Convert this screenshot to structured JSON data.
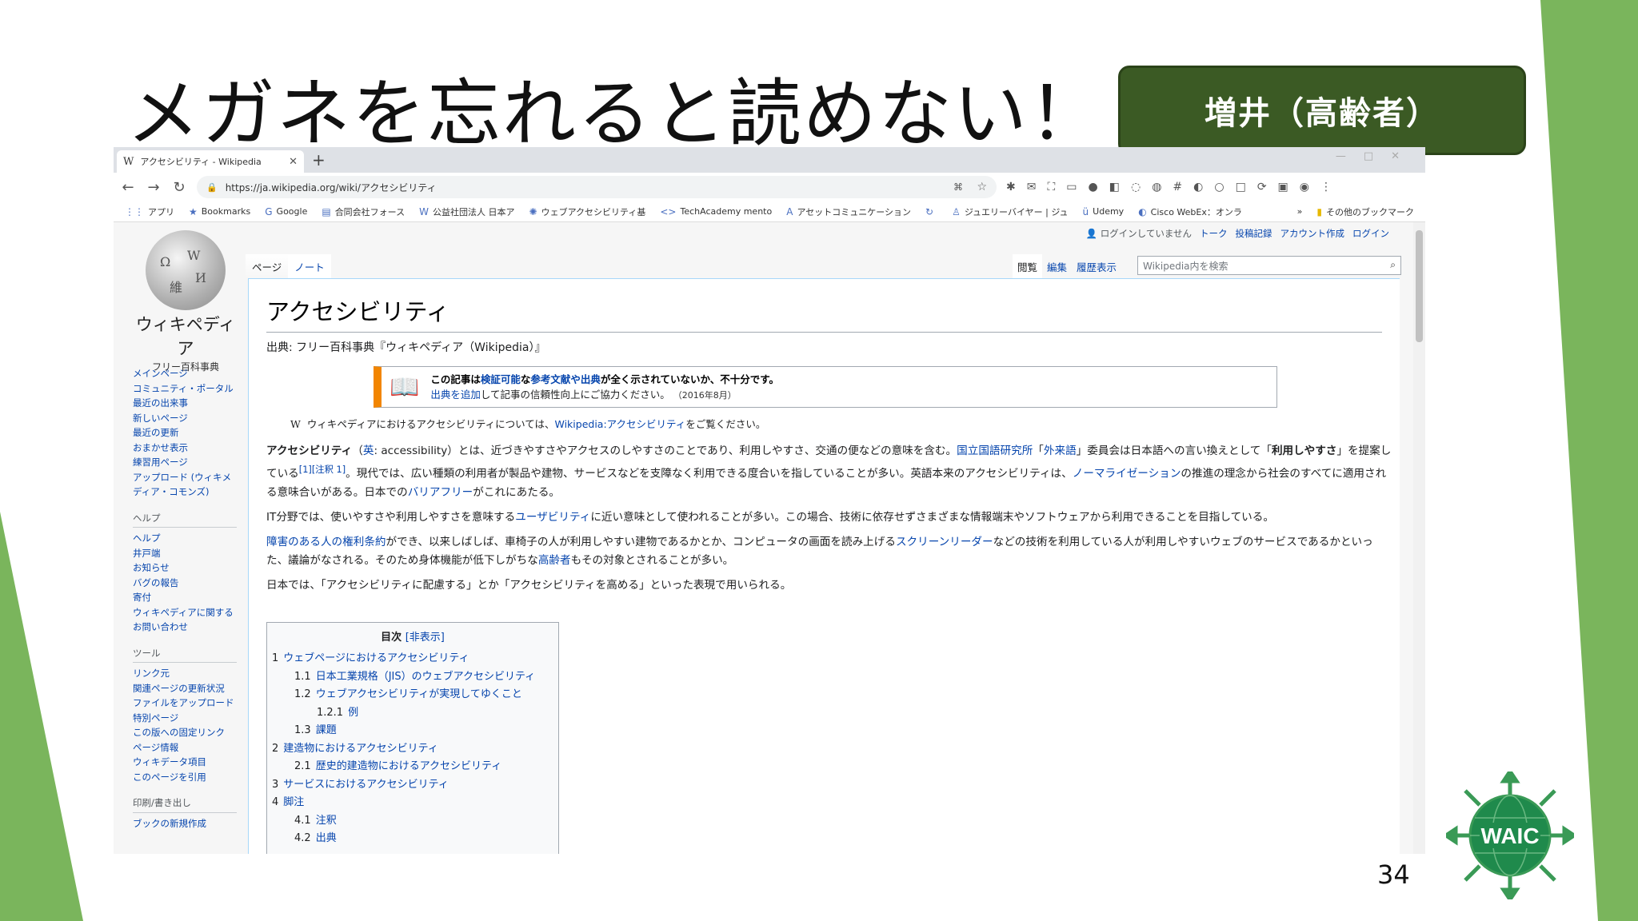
{
  "slide": {
    "title": "メガネを忘れると読めない！",
    "persona": "増井（高齢者）",
    "page_number": "34",
    "logo_text": "WAIC"
  },
  "colors": {
    "accent_green": "#7ab55c",
    "persona_bg": "#3b5a24",
    "link": "#0645ad",
    "ambox_border": "#f28500"
  },
  "browser": {
    "tab_title": "アクセシビリティ - Wikipedia",
    "url": "https://ja.wikipedia.org/wiki/アクセシビリティ",
    "bookmarks": [
      {
        "icon": "apps-icon",
        "label": "アプリ"
      },
      {
        "icon": "star-icon",
        "label": "Bookmarks"
      },
      {
        "icon": "google-icon",
        "label": "Google"
      },
      {
        "icon": "folder-icon",
        "label": "合同会社フォース"
      },
      {
        "icon": "w-icon",
        "label": "公益社団法人 日本ア"
      },
      {
        "icon": "gear-icon",
        "label": "ウェブアクセシビリティ基"
      },
      {
        "icon": "code-icon",
        "label": "TechAcademy mento"
      },
      {
        "icon": "a-icon",
        "label": "アセットコミュニケーション"
      },
      {
        "icon": "refresh-icon",
        "label": ""
      },
      {
        "icon": "person-icon",
        "label": "ジュエリーバイヤー | ジュ"
      },
      {
        "icon": "udemy-icon",
        "label": "Udemy"
      },
      {
        "icon": "webex-icon",
        "label": "Cisco WebEx：オンラ"
      }
    ],
    "more_bookmarks": "»",
    "other_bookmarks": "その他のブックマーク"
  },
  "wiki": {
    "site_name": "ウィキペディア",
    "site_sub": "フリー百科事典",
    "personal": {
      "not_logged": "ログインしていません",
      "talk": "トーク",
      "contribs": "投稿記録",
      "create": "アカウント作成",
      "login": "ログイン"
    },
    "ns_tabs": {
      "page": "ページ",
      "note": "ノート"
    },
    "view_tabs": {
      "read": "閲覧",
      "edit": "編集",
      "history": "履歴表示"
    },
    "search_placeholder": "Wikipedia内を検索",
    "nav": [
      "メインページ",
      "コミュニティ・ポータル",
      "最近の出来事",
      "新しいページ",
      "最近の更新",
      "おまかせ表示",
      "練習用ページ",
      "アップロード (ウィキメディア・コモンズ)"
    ],
    "help_heading": "ヘルプ",
    "help": [
      "ヘルプ",
      "井戸端",
      "お知らせ",
      "バグの報告",
      "寄付",
      "ウィキペディアに関するお問い合わせ"
    ],
    "tools_heading": "ツール",
    "tools": [
      "リンク元",
      "関連ページの更新状況",
      "ファイルをアップロード",
      "特別ページ",
      "この版への固定リンク",
      "ページ情報",
      "ウィキデータ項目",
      "このページを引用"
    ],
    "print_heading": "印刷/書き出し",
    "print": [
      "ブックの新規作成"
    ],
    "article": {
      "title": "アクセシビリティ",
      "source": "出典: フリー百科事典『ウィキペディア（Wikipedia）』",
      "ambox_p1": "この記事は",
      "ambox_l1": "検証可能",
      "ambox_p2": "な",
      "ambox_l2": "参考文献や出典",
      "ambox_p3": "が全く示されていないか、不十分です。",
      "ambox_l3": "出典を追加",
      "ambox_p4": "して記事の信頼性向上にご協力ください。",
      "ambox_date": "（2016年8月）",
      "hatnote_pre": "ウィキペディアにおけるアクセシビリティについては、",
      "hatnote_link": "Wikipedia:アクセシビリティ",
      "hatnote_post": "をご覧ください。",
      "p1_a": "アクセシビリティ",
      "p1_b": "（",
      "p1_c": "英",
      "p1_d": ": accessibility）とは、近づきやすさやアクセスのしやすさのことであり、利用しやすさ、交通の便などの意味を含む。",
      "p1_e": "国立国語研究所",
      "p1_f": "「",
      "p1_g": "外来語",
      "p1_h": "」委員会は日本語への言い換えとして「",
      "p1_i": "利用しやすさ",
      "p1_j": "」を提案している",
      "p1_k": "[1][注釈 1]",
      "p1_l": "。現代では、広い種類の利用者が製品や建物、サービスなどを支障なく利用できる度合いを指していることが多い。英語本来のアクセシビリティは、",
      "p1_m": "ノーマライゼーション",
      "p1_n": "の推進の理念から社会のすべてに適用される意味合いがある。日本での",
      "p1_o": "バリアフリー",
      "p1_p": "がこれにあたる。",
      "p2_a": "IT分野では、使いやすさや利用しやすさを意味する",
      "p2_b": "ユーザビリティ",
      "p2_c": "に近い意味として使われることが多い。この場合、技術に依存せずさまざまな情報端末やソフトウェアから利用できることを目指している。",
      "p3_a": "障害のある人の権利条約",
      "p3_b": "ができ、以来しばしば、車椅子の人が利用しやすい建物であるかとか、コンピュータの画面を読み上げる",
      "p3_c": "スクリーンリーダー",
      "p3_d": "などの技術を利用している人が利用しやすいウェブのサービスであるかといった、議論がなされる。そのため身体機能が低下しがちな",
      "p3_e": "高齢者",
      "p3_f": "もその対象とされることが多い。",
      "p4": "日本では、「アクセシビリティに配慮する」とか「アクセシビリティを高める」といった表現で用いられる。"
    },
    "toc": {
      "title": "目次",
      "toggle": "[非表示]",
      "items": [
        {
          "num": "1",
          "label": "ウェブページにおけるアクセシビリティ",
          "level": 1
        },
        {
          "num": "1.1",
          "label": "日本工業規格（JIS）のウェブアクセシビリティ",
          "level": 2
        },
        {
          "num": "1.2",
          "label": "ウェブアクセシビリティが実現してゆくこと",
          "level": 2
        },
        {
          "num": "1.2.1",
          "label": "例",
          "level": 3
        },
        {
          "num": "1.3",
          "label": "課題",
          "level": 2
        },
        {
          "num": "2",
          "label": "建造物におけるアクセシビリティ",
          "level": 1
        },
        {
          "num": "2.1",
          "label": "歴史的建造物におけるアクセシビリティ",
          "level": 2
        },
        {
          "num": "3",
          "label": "サービスにおけるアクセシビリティ",
          "level": 1
        },
        {
          "num": "4",
          "label": "脚注",
          "level": 1
        },
        {
          "num": "4.1",
          "label": "注釈",
          "level": 2
        },
        {
          "num": "4.2",
          "label": "出典",
          "level": 2
        }
      ]
    }
  }
}
